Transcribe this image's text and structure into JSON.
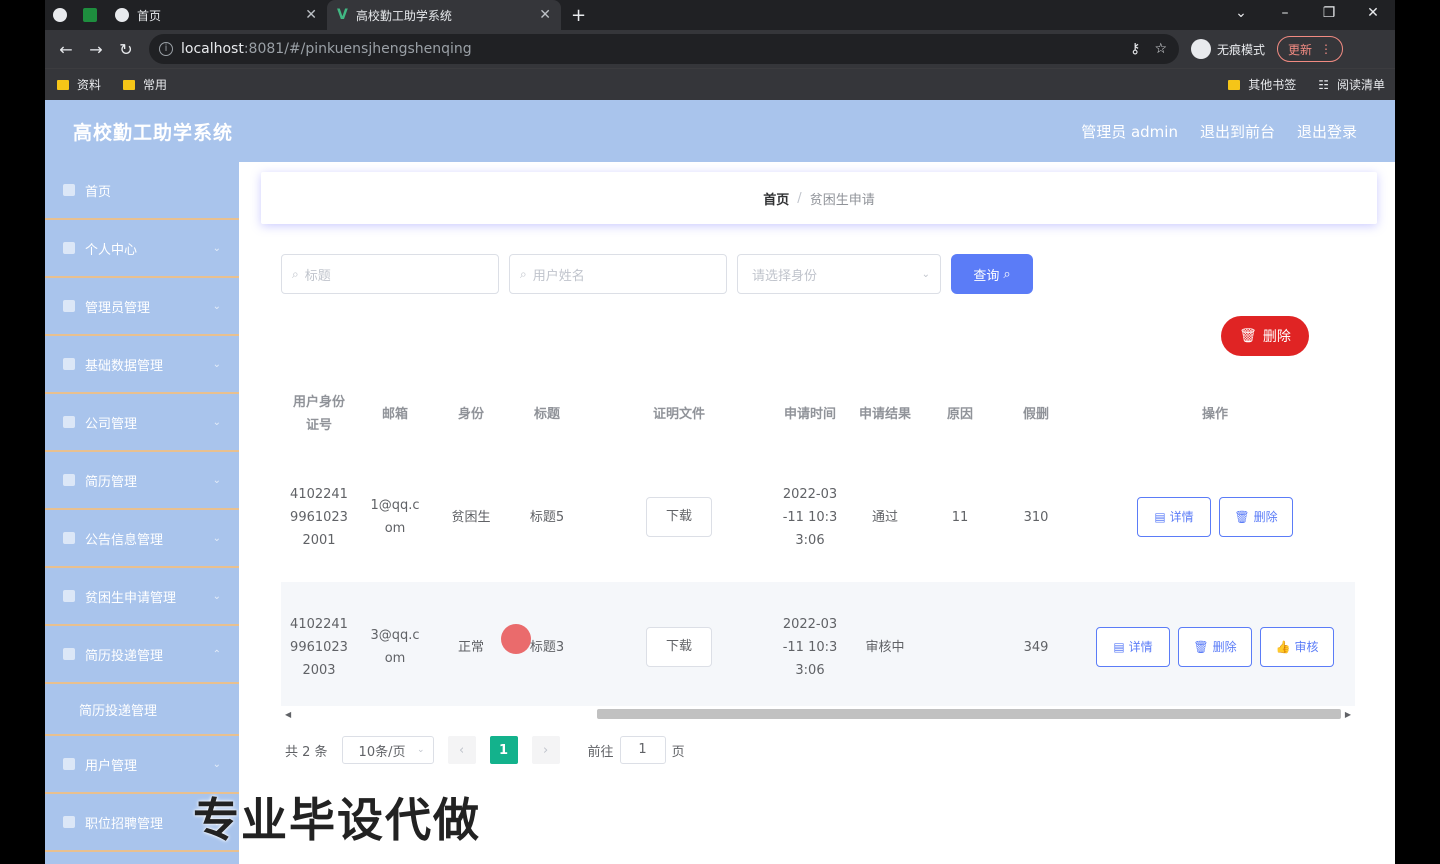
{
  "browser": {
    "tabs": [
      {
        "title": "首页"
      },
      {
        "title": "高校勤工助学系统"
      }
    ],
    "url_host": "localhost",
    "url_path": ":8081/#/pinkuensjhengshenqing",
    "incognito_label": "无痕模式",
    "update_label": "更新",
    "bookmarks": [
      "资料",
      "常用"
    ],
    "bookmarks_right": [
      "其他书签",
      "阅读清单"
    ]
  },
  "app": {
    "title": "高校勤工助学系统",
    "header_links": [
      "管理员 admin",
      "退出到前台",
      "退出登录"
    ]
  },
  "sidebar": {
    "items": [
      {
        "label": "首页",
        "icon": "home-icon"
      },
      {
        "label": "个人中心",
        "icon": "user-icon"
      },
      {
        "label": "管理员管理",
        "icon": "admin-icon"
      },
      {
        "label": "基础数据管理",
        "icon": "grid-icon"
      },
      {
        "label": "公司管理",
        "icon": "company-icon"
      },
      {
        "label": "简历管理",
        "icon": "resume-icon"
      },
      {
        "label": "公告信息管理",
        "icon": "list-icon"
      },
      {
        "label": "贫困生申请管理",
        "icon": "folder-icon"
      },
      {
        "label": "简历投递管理",
        "icon": "list-icon"
      }
    ],
    "submenu": "简历投递管理",
    "items_after": [
      {
        "label": "用户管理",
        "icon": "user-icon"
      },
      {
        "label": "职位招聘管理",
        "icon": "chart-icon"
      }
    ]
  },
  "breadcrumb": {
    "home": "首页",
    "sep": "/",
    "current": "贫困生申请"
  },
  "search": {
    "title_placeholder": "标题",
    "name_placeholder": "用户姓名",
    "identity_placeholder": "请选择身份",
    "query_label": "查询"
  },
  "actions": {
    "delete_label": "删除"
  },
  "table": {
    "headers": [
      "用户身份\n证号",
      "邮箱",
      "身份",
      "标题",
      "证明文件",
      "申请时间",
      "申请结果",
      "原因",
      "假删",
      "操作"
    ],
    "download_label": "下载",
    "detail_label": "详情",
    "delete_label": "删除",
    "audit_label": "审核",
    "rows": [
      {
        "id": "4102241\n9961023\n2001",
        "email": "1@qq.c\nom",
        "identity": "贫困生",
        "title": "标题5",
        "time": "2022-03\n-11 10:3\n3:06",
        "result": "通过",
        "reason": "11",
        "fake_del": "310"
      },
      {
        "id": "4102241\n9961023\n2003",
        "email": "3@qq.c\nom",
        "identity": "正常",
        "title": "标题3",
        "time": "2022-03\n-11 10:3\n3:06",
        "result": "审核中",
        "reason": "",
        "fake_del": "349"
      }
    ]
  },
  "pagination": {
    "total": "共 2 条",
    "page_size": "10条/页",
    "current_page": "1",
    "goto_prefix": "前往",
    "goto_value": "1",
    "goto_suffix": "页"
  },
  "watermark": "专业毕设代做",
  "colors": {
    "header_bg": "#a9c4ec",
    "primary": "#5b7cf7",
    "danger": "#e02424",
    "page_active": "#13b28c"
  }
}
